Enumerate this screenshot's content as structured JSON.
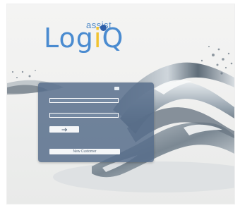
{
  "logo": {
    "assist": "assist",
    "log": "Log",
    "i": "i",
    "q": "Q"
  },
  "login": {
    "username_placeholder": "",
    "password_placeholder": "",
    "submit_icon": "arrow-right-icon",
    "new_customer_label": "New Customer"
  },
  "colors": {
    "logo_blue": "#4a8bd0",
    "logo_yellow": "#f1c22f",
    "panel": "#566c8a"
  }
}
